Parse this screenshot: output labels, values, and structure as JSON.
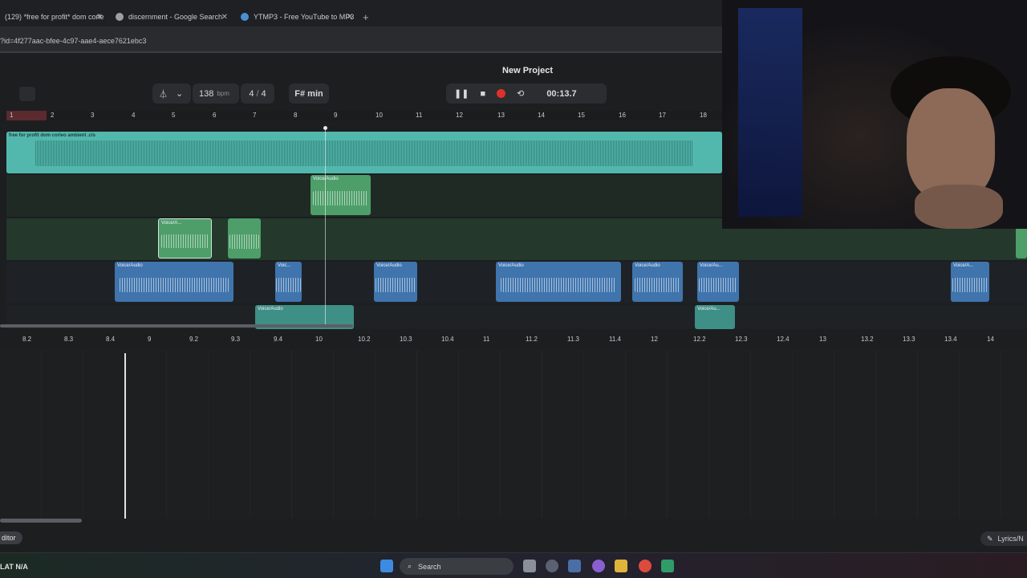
{
  "browser": {
    "tabs": [
      {
        "label": "(129) *free for profit* dom corle",
        "close": "✕"
      },
      {
        "label": "discernment - Google Search",
        "close": "✕"
      },
      {
        "label": "YTMP3 - Free YouTube to MP3",
        "close": "✕"
      }
    ],
    "new_tab": "+",
    "url": "?id=4f277aac-bfee-4c97-aae4-aece7621ebc3"
  },
  "daw": {
    "project_title": "New Project",
    "bpm_value": "138",
    "bpm_unit": "bpm",
    "time_sig_num": "4",
    "time_sig_sep": "/",
    "time_sig_den": "4",
    "key": "F# min",
    "time_display": "00:13.7",
    "ruler_ticks": [
      "1",
      "2",
      "3",
      "4",
      "5",
      "6",
      "7",
      "8",
      "9",
      "10",
      "11",
      "12",
      "13",
      "14",
      "15",
      "16",
      "17",
      "18"
    ],
    "tracks": [
      {
        "clips": [
          {
            "label": "free for profit dom corleo ambient .cls",
            "color": "#52b8ad"
          }
        ]
      },
      {
        "clips": [
          {
            "label": "Voice/Audio",
            "color": "#4d9e69"
          }
        ]
      },
      {
        "clips": [
          {
            "label": "Voice/A...",
            "color": "#4d9e69"
          },
          {
            "label": "",
            "color": "#4d9e69"
          }
        ]
      },
      {
        "clips": [
          {
            "label": "Voice/Audio"
          },
          {
            "label": "Voic..."
          },
          {
            "label": "Voice/Audio"
          },
          {
            "label": "Voice/Audio"
          },
          {
            "label": "Voice/Audio"
          },
          {
            "label": "Voice/Au..."
          },
          {
            "label": "Voice/A..."
          }
        ]
      },
      {
        "clips": [
          {
            "label": "Voice/Audio"
          },
          {
            "label": "Voice/Au..."
          }
        ]
      }
    ],
    "editor_ruler": [
      "8.2",
      "8.3",
      "8.4",
      "9",
      "9.2",
      "9.3",
      "9.4",
      "10",
      "10.2",
      "10.3",
      "10.4",
      "11",
      "11.2",
      "11.3",
      "11.4",
      "12",
      "12.2",
      "12.3",
      "12.4",
      "13",
      "13.2",
      "13.3",
      "13.4",
      "14"
    ],
    "editor_tab": "ditor",
    "lyrics_tab": "Lyrics/N"
  },
  "taskbar": {
    "status": "LAT  N/A",
    "search_placeholder": "Search"
  }
}
